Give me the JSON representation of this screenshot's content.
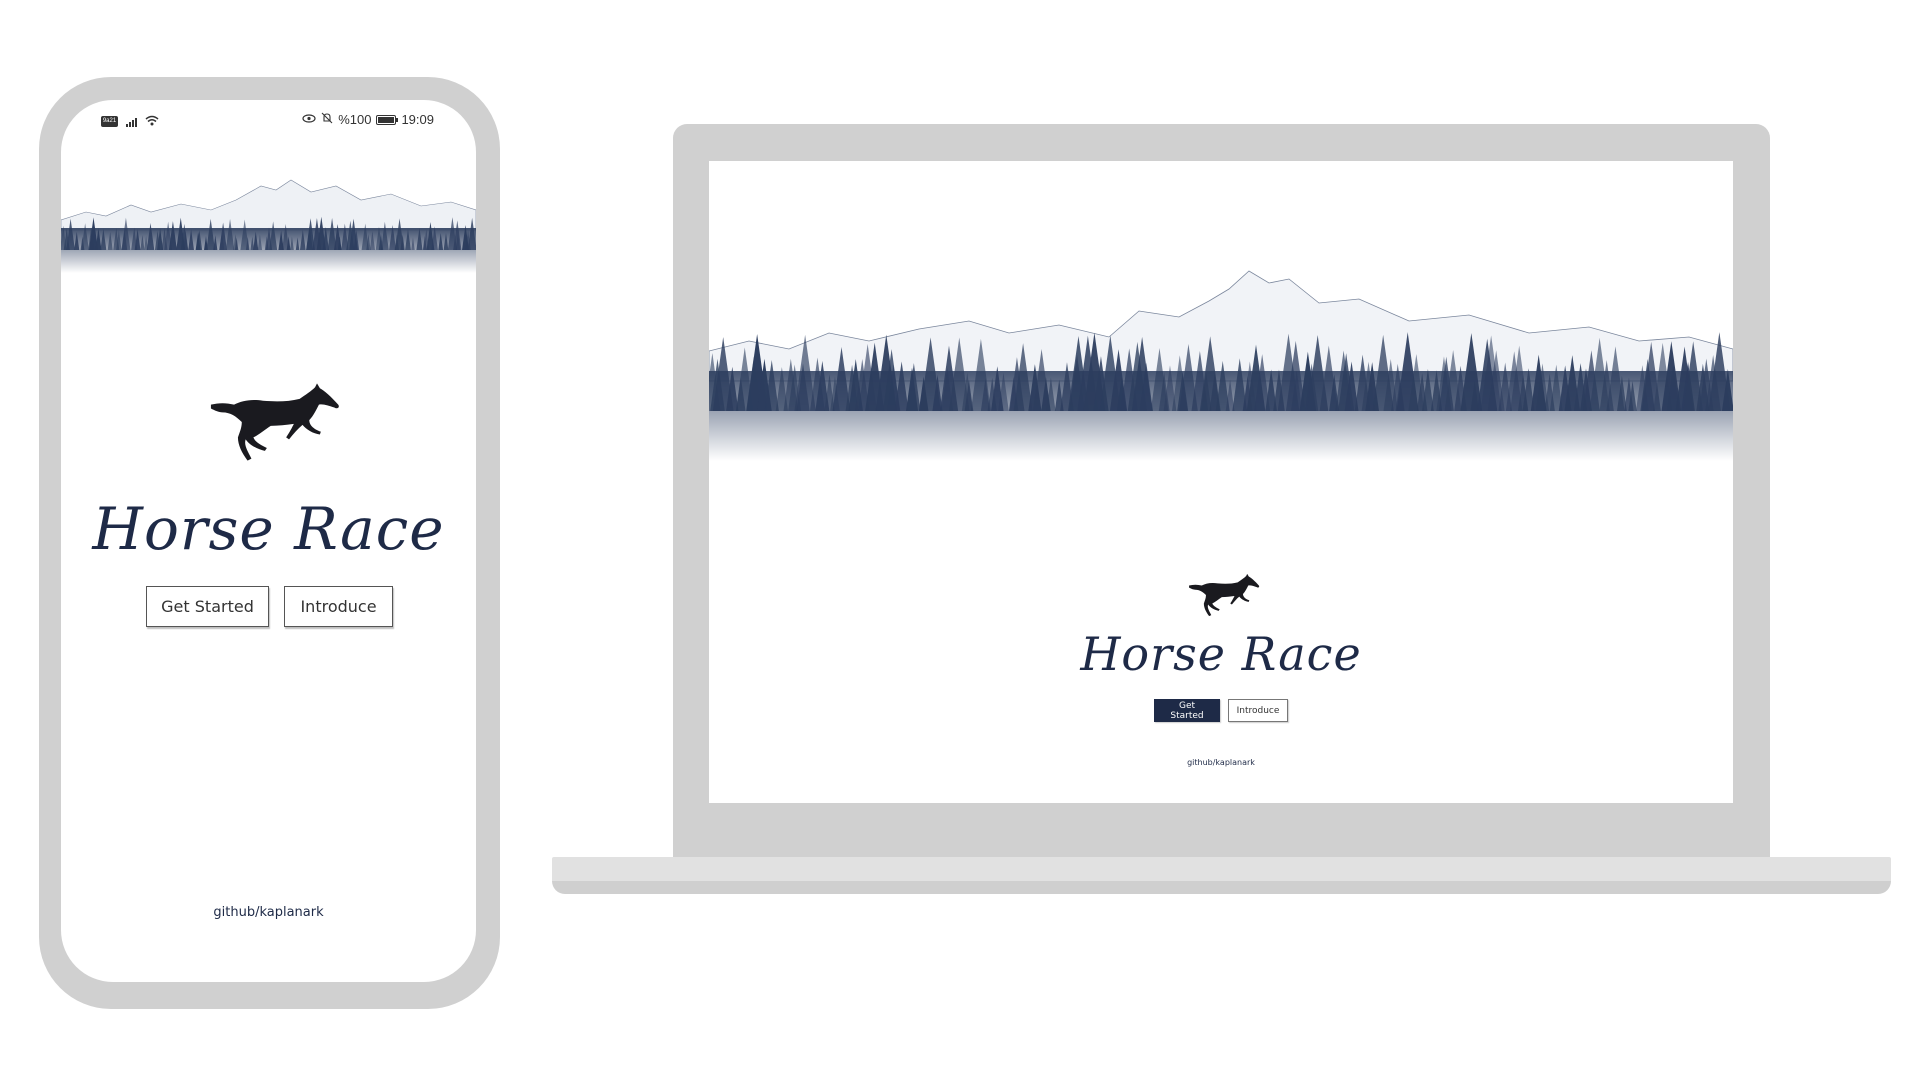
{
  "phone": {
    "status": {
      "sim_label": "9a21",
      "battery_text": "%100",
      "time": "19:09"
    },
    "title": "Horse Race",
    "buttons": {
      "get_started": "Get Started",
      "introduce": "Introduce"
    },
    "footer": "github/kaplanark"
  },
  "laptop": {
    "title": "Horse Race",
    "buttons": {
      "get_started": "Get Started",
      "introduce": "Introduce"
    },
    "footer": "github/kaplanark"
  },
  "icons": {
    "banner": "mountain-forest-illustration",
    "logo": "running-horse-icon"
  },
  "colors": {
    "brand_navy": "#1e2a47",
    "device_frame": "#d0d0d0",
    "screen_bg": "#ffffff"
  }
}
